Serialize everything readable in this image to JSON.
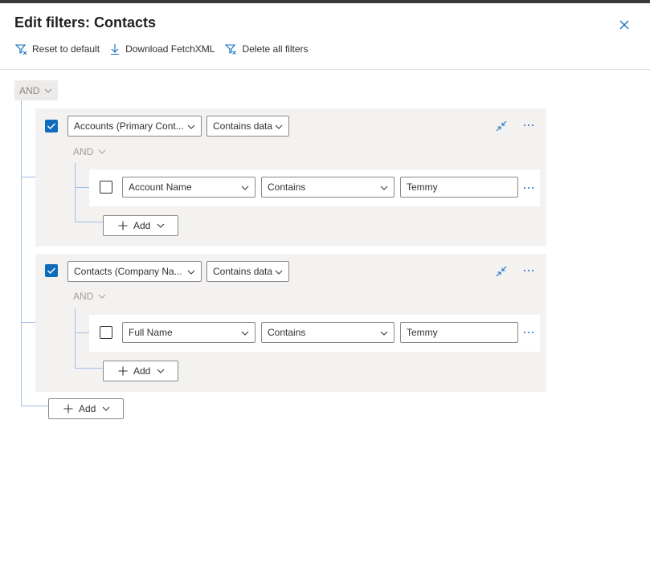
{
  "dialog": {
    "title": "Edit filters: Contacts",
    "close_icon": "close-icon"
  },
  "toolbar": {
    "reset_label": "Reset to default",
    "download_label": "Download FetchXML",
    "delete_label": "Delete all filters"
  },
  "root_operator": "AND",
  "groups": [
    {
      "checked": true,
      "field": "Accounts (Primary Cont...",
      "operator": "Contains data",
      "inner_operator": "AND",
      "row": {
        "checked": false,
        "field": "Account Name",
        "condition": "Contains",
        "value": "Temmy"
      },
      "add_label": "Add"
    },
    {
      "checked": true,
      "field": "Contacts (Company Na...",
      "operator": "Contains data",
      "inner_operator": "AND",
      "row": {
        "checked": false,
        "field": "Full Name",
        "condition": "Contains",
        "value": "Temmy"
      },
      "add_label": "Add"
    }
  ],
  "root_add_label": "Add",
  "colors": {
    "accent": "#0f6cbd",
    "connector": "#9dbfe8",
    "group_bg": "#f3f2f1"
  }
}
